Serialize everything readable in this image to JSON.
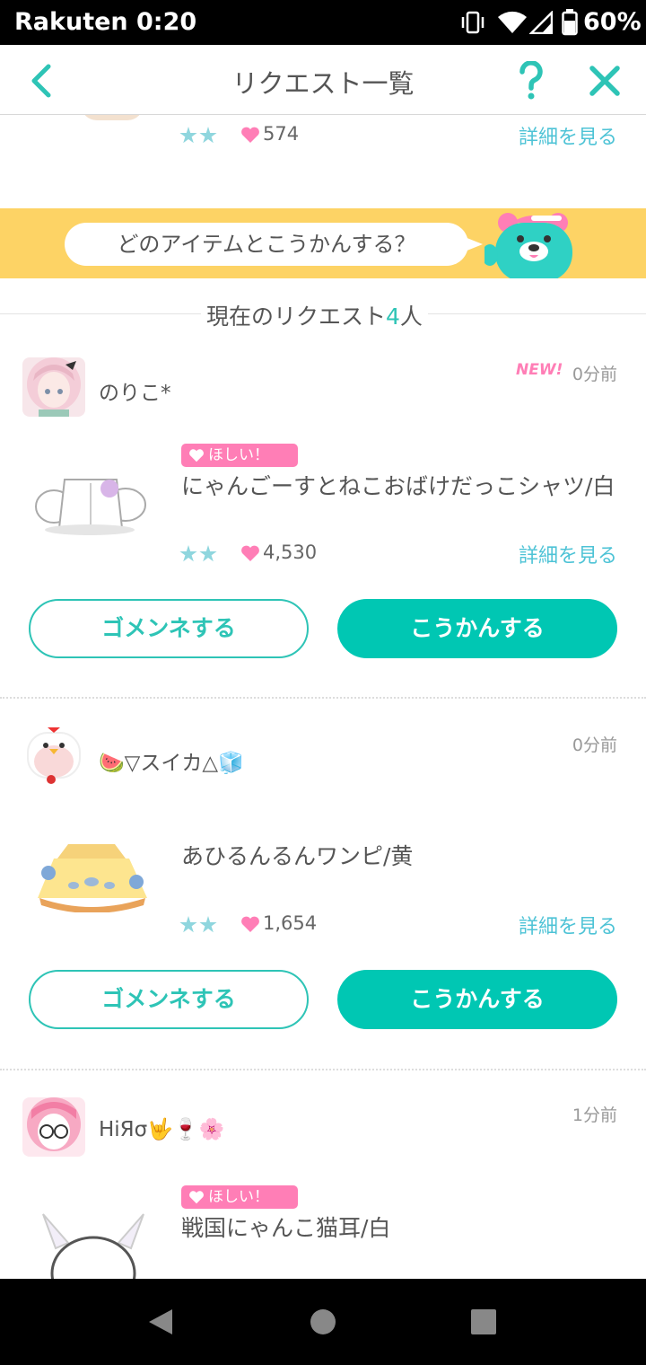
{
  "status_bar": {
    "carrier": "Rakuten",
    "time": "0:20",
    "battery": "60%"
  },
  "header": {
    "title": "リクエスト一覧",
    "back_icon": "chevron-left-icon",
    "help_icon": "question-icon",
    "close_icon": "close-icon"
  },
  "colors": {
    "accent": "#00c7b3",
    "pink": "#ff7eb6",
    "banner": "#fdd365",
    "link": "#4ec3d6"
  },
  "top_item": {
    "likes": "574",
    "detail_label": "詳細を見る"
  },
  "banner": {
    "text": "どのアイテムとこうかんする？"
  },
  "request_count": {
    "prefix": "現在のリクエスト",
    "number": "4",
    "suffix": "人"
  },
  "requests": [
    {
      "username": "のりこ*",
      "new_badge": "NEW!",
      "time": "0分前",
      "want_badge": "ほしい！",
      "item_name": "にゃんごーすとねこおばけだっこシャツ/白",
      "likes": "4,530",
      "detail_label": "詳細を見る",
      "decline_label": "ゴメンネする",
      "accept_label": "こうかんする"
    },
    {
      "username": "🍉▽スイカ△🧊",
      "time": "0分前",
      "item_name": "あひるんるんワンピ/黄",
      "likes": "1,654",
      "detail_label": "詳細を見る",
      "decline_label": "ゴメンネする",
      "accept_label": "こうかんする"
    },
    {
      "username": "HiЯσ🤟🍷🌸",
      "time": "1分前",
      "want_badge": "ほしい！",
      "item_name": "戦国にゃんこ猫耳/白"
    }
  ]
}
